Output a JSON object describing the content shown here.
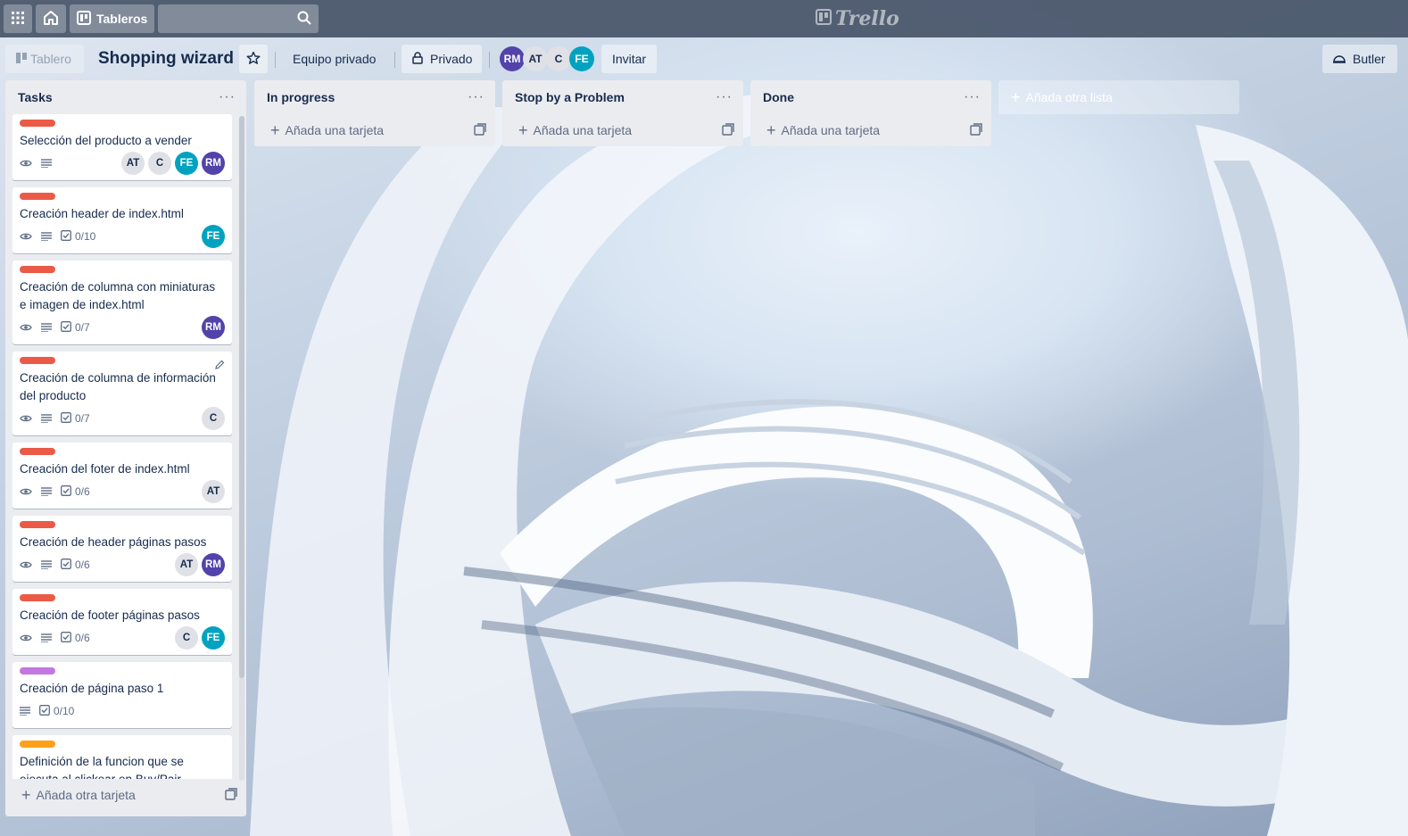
{
  "header": {
    "apps_icon": "apps-grid-icon",
    "home_icon": "home-icon",
    "boards_label": "Tableros",
    "search_placeholder": "",
    "logo_text": "Trello"
  },
  "board": {
    "view_label": "Tablero",
    "title": "Shopping wizard",
    "team_label": "Equipo privado",
    "privacy_label": "Privado",
    "invite_label": "Invitar",
    "butler_label": "Butler",
    "members": [
      "RM",
      "AT",
      "C",
      "FE"
    ]
  },
  "lists": [
    {
      "title": "Tasks",
      "add_label": "Añada otra tarjeta",
      "cards": [
        {
          "label_color": "#eb5a46",
          "title": "Selección del producto a vender",
          "watch": true,
          "desc": true,
          "checklist": "",
          "members": [
            "AT",
            "C",
            "FE",
            "RM"
          ]
        },
        {
          "label_color": "#eb5a46",
          "title": "Creación header de index.html",
          "watch": true,
          "desc": true,
          "checklist": "0/10",
          "members": [
            "FE"
          ]
        },
        {
          "label_color": "#eb5a46",
          "title": "Creación de columna con miniaturas e imagen de index.html",
          "watch": true,
          "desc": true,
          "checklist": "0/7",
          "members": [
            "RM"
          ]
        },
        {
          "label_color": "#eb5a46",
          "title": "Creación de columna de información del producto",
          "watch": true,
          "desc": true,
          "checklist": "0/7",
          "members": [
            "C"
          ]
        },
        {
          "label_color": "#eb5a46",
          "title": "Creación del foter de index.html",
          "watch": true,
          "desc": true,
          "checklist": "0/6",
          "members": [
            "AT"
          ]
        },
        {
          "label_color": "#eb5a46",
          "title": "Creación de header páginas pasos",
          "watch": true,
          "desc": true,
          "checklist": "0/6",
          "members": [
            "AT",
            "RM"
          ]
        },
        {
          "label_color": "#eb5a46",
          "title": "Creación de footer páginas pasos",
          "watch": true,
          "desc": true,
          "checklist": "0/6",
          "members": [
            "C",
            "FE"
          ]
        },
        {
          "label_color": "#c377e0",
          "title": "Creación de página paso 1",
          "watch": false,
          "desc": true,
          "checklist": "0/10",
          "members": []
        },
        {
          "label_color": "#ff9f1a",
          "title": "Definición de la funcion que se ejecuta al clickear en Buy/Pair",
          "watch": false,
          "desc": false,
          "checklist": "",
          "members": []
        }
      ]
    },
    {
      "title": "In progress",
      "add_label": "Añada una tarjeta",
      "cards": []
    },
    {
      "title": "Stop by a Problem",
      "add_label": "Añada una tarjeta",
      "cards": []
    },
    {
      "title": "Done",
      "add_label": "Añada una tarjeta",
      "cards": []
    }
  ],
  "add_list_label": "Añada otra lista",
  "colors": {
    "header_bg": "#465468",
    "list_bg": "#ebecf0",
    "avatar_rm": "#5243aa",
    "avatar_fe": "#00a3bf",
    "avatar_neutral": "#dfe1e6"
  }
}
